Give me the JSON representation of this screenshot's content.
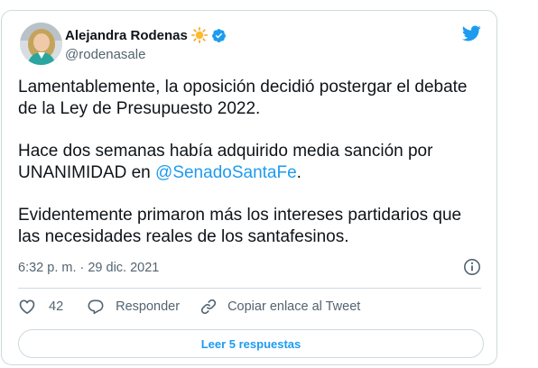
{
  "author": {
    "display_name": "Alejandra Rodenas",
    "handle": "@rodenasale",
    "name_emoji": "sun-icon",
    "verified": true,
    "avatar": "avatar"
  },
  "tweet": {
    "paragraph_1": "Lamentablemente, la oposición decidió postergar el debate de la Ley de Presupuesto 2022.",
    "paragraph_2_text": "Hace dos semanas había adquirido media sanción por UNANIMIDAD en ",
    "paragraph_2_mention": "@SenadoSantaFe",
    "paragraph_2_end": ".",
    "paragraph_3": "Evidentemente primaron más los intereses partidarios que las necesidades reales de los santafesinos.",
    "timestamp": "6:32 p. m. · 29 dic. 2021"
  },
  "actions": {
    "like_count": "42",
    "reply_label": "Responder",
    "copy_label": "Copiar enlace al Tweet"
  },
  "read_replies_label": "Leer 5 respuestas",
  "colors": {
    "brand": "#1d9bf0",
    "text": "#0f1419",
    "secondary": "#536471",
    "border": "#cfd9de"
  }
}
